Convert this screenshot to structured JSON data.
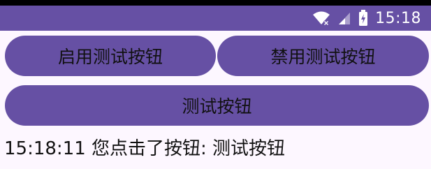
{
  "status_bar": {
    "time": "15:18",
    "icons": [
      "wifi-icon",
      "signal-icon",
      "battery-charging-icon"
    ],
    "color": "#6650a4"
  },
  "buttons": {
    "enable_label": "启用测试按钮",
    "disable_label": "禁用测试按钮",
    "test_label": "测试按钮"
  },
  "log": {
    "text": "15:18:11 您点击了按钮: 测试按钮"
  },
  "colors": {
    "accent": "#6650a4",
    "background": "#fdf7ff",
    "text": "#111111"
  }
}
